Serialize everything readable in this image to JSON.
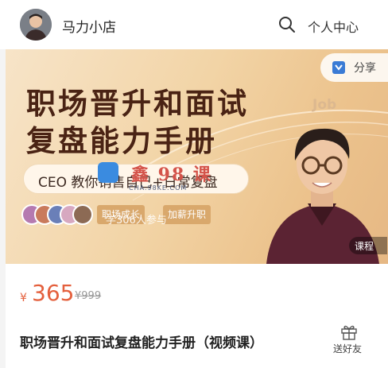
{
  "header": {
    "shop_name": "马力小店",
    "profile_label": "个人中心"
  },
  "banner": {
    "title_line1": "职场晋升和面试",
    "title_line2": "复盘能力手册",
    "decor_text": "Job",
    "share_label": "分享",
    "subtitle": "CEO 教你销售自己+日常复盘",
    "tags": [
      "职场成长",
      "加薪升职"
    ],
    "watermark_text": "鑫 98 课",
    "watermark_url": "CHA.98KE.COM",
    "learners_text": "学306人参与",
    "course_badge": "课程"
  },
  "product": {
    "currency": "¥",
    "price": "365",
    "original_price": "¥999",
    "title": "职场晋升和面试复盘能力手册（视频课）",
    "gift_label": "送好友"
  },
  "colors": {
    "price": "#e4603d",
    "title_brown": "#4a2314",
    "tag_bg": "#d9a86c"
  },
  "icons": [
    "search-icon",
    "share-icon",
    "gift-icon"
  ]
}
